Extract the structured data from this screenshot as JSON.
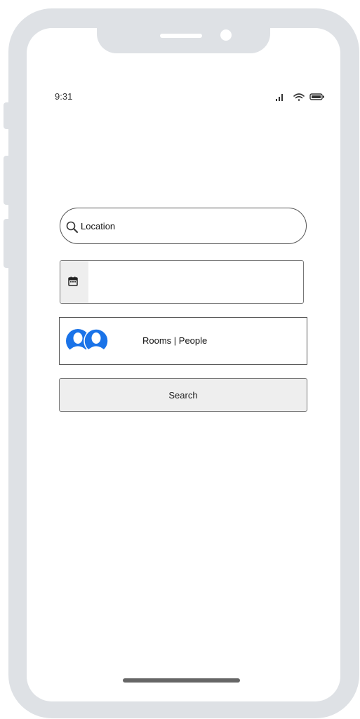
{
  "status_bar": {
    "time": "9:31",
    "icons": [
      "signal-icon",
      "wifi-icon",
      "battery-icon"
    ]
  },
  "search_form": {
    "location_placeholder": "Location",
    "date_value": "",
    "guests_label": "Rooms | People",
    "search_button_label": "Search"
  },
  "colors": {
    "frame": "#dee1e5",
    "accent_blue": "#1a73e8",
    "button_fill": "#eeeeee"
  }
}
